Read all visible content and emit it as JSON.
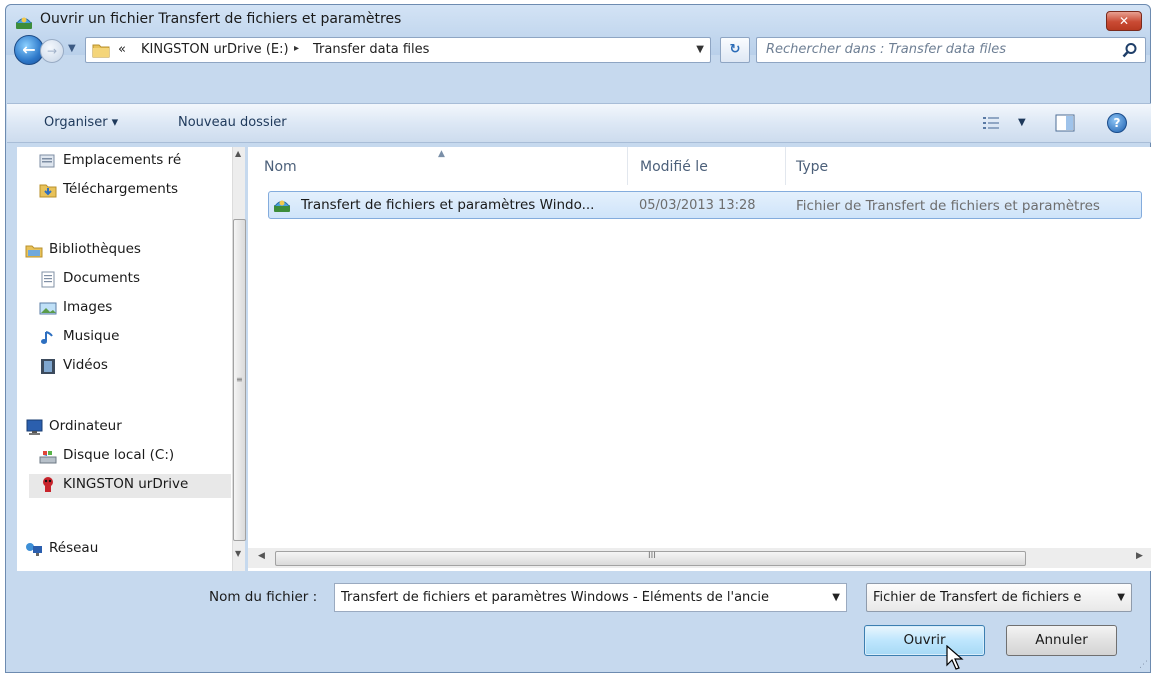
{
  "window": {
    "title": "Ouvrir un fichier Transfert de fichiers et paramètres",
    "close_label": "✕"
  },
  "address": {
    "overflow_chevrons": "«",
    "crumbs": [
      "KINGSTON urDrive (E:)",
      "Transfer data files"
    ],
    "separator": "▸",
    "dropdown": "▼",
    "refresh": "↻"
  },
  "search": {
    "placeholder": "Rechercher dans : Transfer data files"
  },
  "toolbar": {
    "organise_label": "Organiser ▾",
    "new_folder_label": "Nouveau dossier",
    "view_arrow": "▼",
    "help_label": "?"
  },
  "nav": {
    "items": [
      {
        "label": "Emplacements ré",
        "icon": "recent-places-icon"
      },
      {
        "label": "Téléchargements",
        "icon": "downloads-folder-icon"
      },
      {
        "label": "Bibliothèques",
        "icon": "libraries-icon"
      },
      {
        "label": "Documents",
        "icon": "documents-icon"
      },
      {
        "label": "Images",
        "icon": "images-icon"
      },
      {
        "label": "Musique",
        "icon": "music-icon"
      },
      {
        "label": "Vidéos",
        "icon": "videos-icon"
      },
      {
        "label": "Ordinateur",
        "icon": "computer-icon"
      },
      {
        "label": "Disque local (C:)",
        "icon": "local-disk-icon"
      },
      {
        "label": "KINGSTON urDrive",
        "icon": "usb-drive-icon"
      },
      {
        "label": "Réseau",
        "icon": "network-icon"
      }
    ],
    "selected_index": 9
  },
  "files": {
    "columns": [
      "Nom",
      "Modifié le",
      "Type"
    ],
    "rows": [
      {
        "name": "Transfert de fichiers et paramètres Windo...",
        "modified": "05/03/2013 13:28",
        "type": "Fichier de Transfert de fichiers et paramètres"
      }
    ]
  },
  "scroll": {
    "grip": "≡",
    "hgrip": "III"
  },
  "footer": {
    "filename_label": "Nom du fichier :",
    "filename_value": "Transfert de fichiers et paramètres Windows - Éléments de l'ancie",
    "filetype_value": "Fichier de Transfert de fichiers e",
    "open_label": "Ouvrir",
    "cancel_label": "Annuler"
  },
  "colors": {
    "accent": "#3c7fb1",
    "selection": "#cfe4fa",
    "chrome": "#c6d9ee"
  }
}
